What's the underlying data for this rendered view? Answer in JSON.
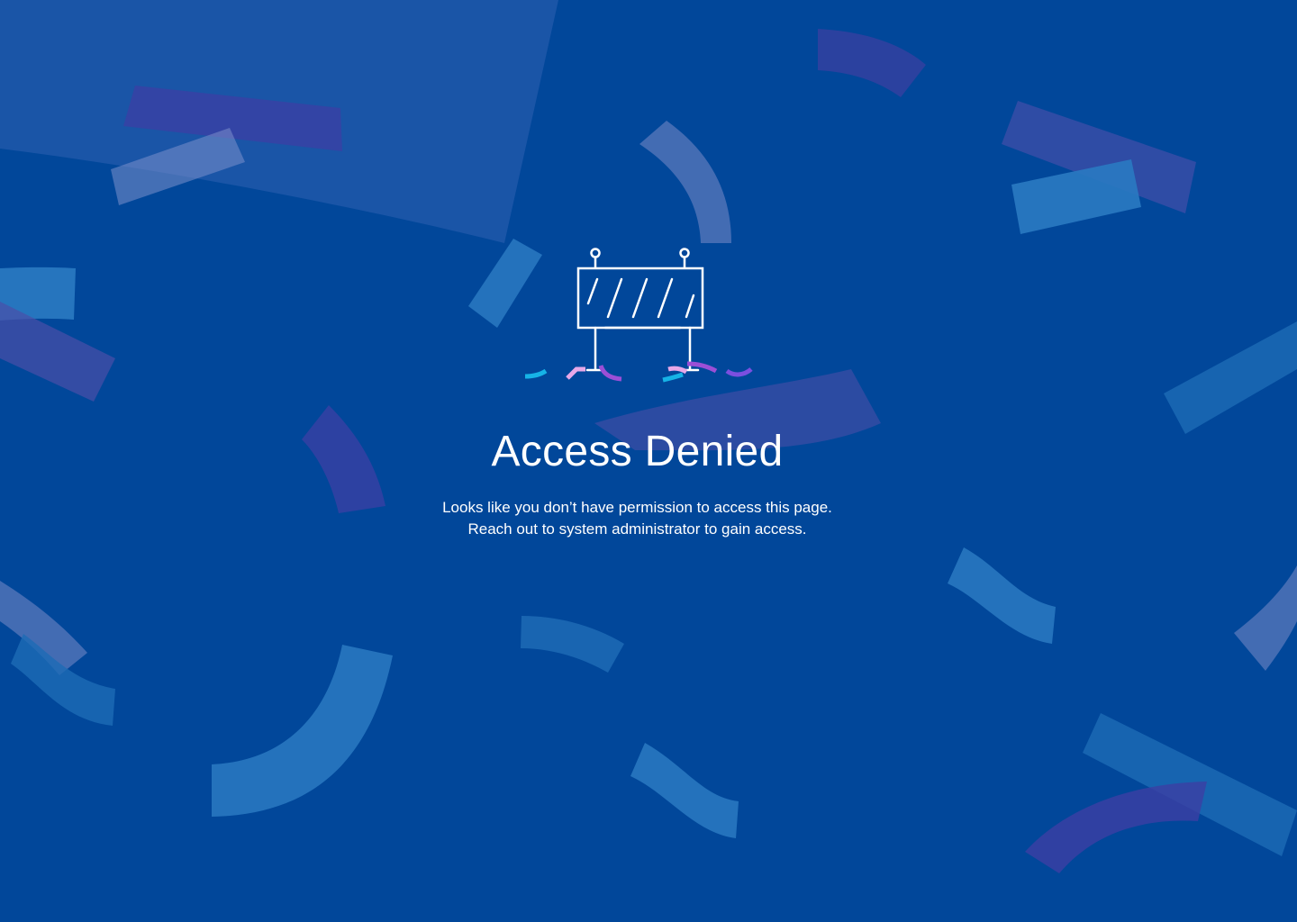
{
  "page": {
    "title": "Access Denied",
    "message_line1": "Looks like you don’t have permission to access this page.",
    "message_line2": "Reach out to system administrator to gain access."
  },
  "illustration": {
    "icon": "barrier-icon",
    "confetti_colors": [
      "#16b3e6",
      "#e7a8e8",
      "#9b4fd6",
      "#7b4fe0"
    ]
  },
  "colors": {
    "background": "#01479a",
    "text": "#ffffff",
    "shape_light_blue": "#2a7ac2",
    "shape_purple": "#3a3fa0",
    "shape_pale": "#6f86c4"
  }
}
